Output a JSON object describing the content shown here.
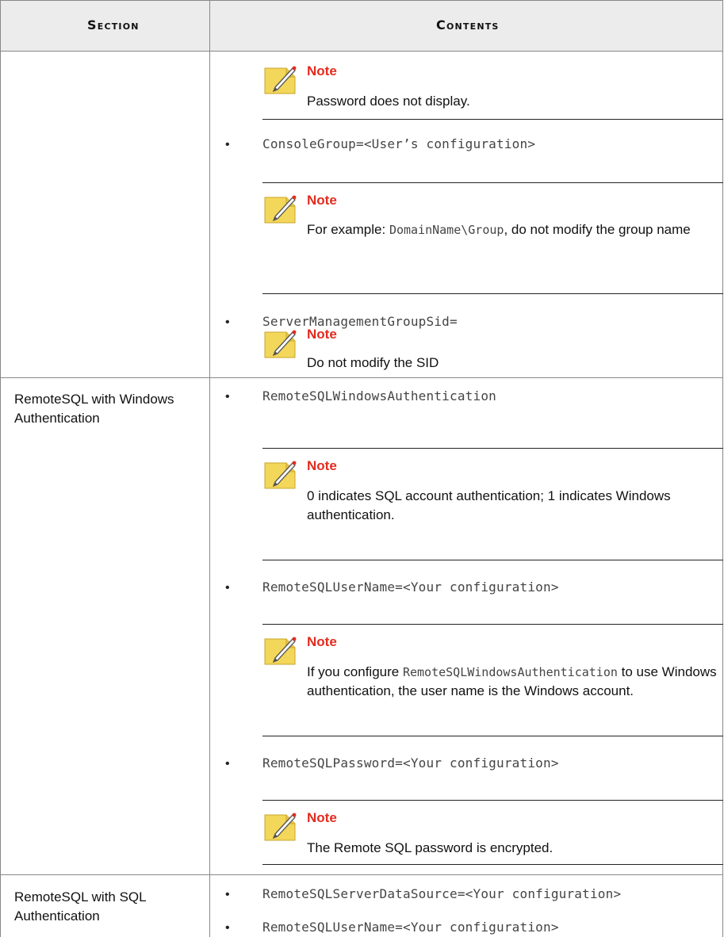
{
  "header": {
    "section": "Section",
    "contents": "Contents"
  },
  "row1": {
    "note1": {
      "label": "Note",
      "body": "Password does not display."
    },
    "item1": "ConsoleGroup=<User’s configuration>",
    "note2": {
      "label": "Note",
      "body_pre": "For example: ",
      "body_code": "DomainName\\Group",
      "body_post": ", do not modify the group name"
    },
    "item2": "ServerManagementGroupSid=",
    "note3": {
      "label": "Note",
      "body": "Do not modify the SID"
    }
  },
  "row2": {
    "section": "RemoteSQL with Windows Authentication",
    "item1": "RemoteSQLWindowsAuthentication",
    "note1": {
      "label": "Note",
      "body": "0 indicates SQL account authentication; 1 indicates Windows authentication."
    },
    "item2": "RemoteSQLUserName=<Your configuration>",
    "note2": {
      "label": "Note",
      "body_pre": "If you configure ",
      "body_code": "RemoteSQLWindowsAuthentication",
      "body_post": " to use Windows authentication, the user name is the Windows account."
    },
    "item3": "RemoteSQLPassword=<Your configuration>",
    "note3": {
      "label": "Note",
      "body": "The Remote SQL password is encrypted."
    }
  },
  "row3": {
    "section": "RemoteSQL with SQL Authentication",
    "item1": "RemoteSQLServerDataSource=<Your configuration>",
    "item2": "RemoteSQLUserName=<Your configuration>"
  },
  "bullet": "•",
  "colors": {
    "note_accent": "#e32b1e",
    "note_icon": "#f3d75a",
    "header_bg": "#ececec"
  },
  "icons": {
    "note": "note-pencil-icon"
  }
}
